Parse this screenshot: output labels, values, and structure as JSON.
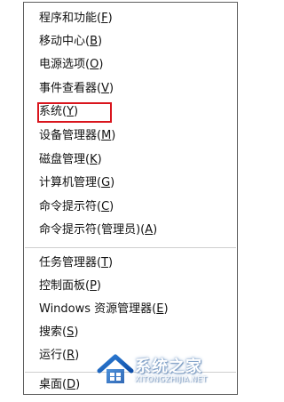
{
  "menu": {
    "items": [
      {
        "label": "程序和功能(",
        "key": "F",
        "close": ")"
      },
      {
        "label": "移动中心(",
        "key": "B",
        "close": ")"
      },
      {
        "label": "电源选项(",
        "key": "O",
        "close": ")"
      },
      {
        "label": "事件查看器(",
        "key": "V",
        "close": ")"
      },
      {
        "label": "系统(",
        "key": "Y",
        "close": ")"
      },
      {
        "label": "设备管理器(",
        "key": "M",
        "close": ")"
      },
      {
        "label": "磁盘管理(",
        "key": "K",
        "close": ")"
      },
      {
        "label": "计算机管理(",
        "key": "G",
        "close": ")"
      },
      {
        "label": "命令提示符(",
        "key": "C",
        "close": ")"
      },
      {
        "label": "命令提示符(管理员)(",
        "key": "A",
        "close": ")"
      },
      {
        "label": "任务管理器(",
        "key": "T",
        "close": ")"
      },
      {
        "label": "控制面板(",
        "key": "P",
        "close": ")"
      },
      {
        "label": "Windows 资源管理器(",
        "key": "E",
        "close": ")"
      },
      {
        "label": "搜索(",
        "key": "S",
        "close": ")"
      },
      {
        "label": "运行(",
        "key": "R",
        "close": ")"
      },
      {
        "label": "桌面(",
        "key": "D",
        "close": ")"
      }
    ],
    "highlight_color": "#d9151d"
  },
  "watermark": {
    "title": "系统之家",
    "subtitle": "XITONGZHIJIA.NET",
    "icon": "house-logo-icon"
  }
}
